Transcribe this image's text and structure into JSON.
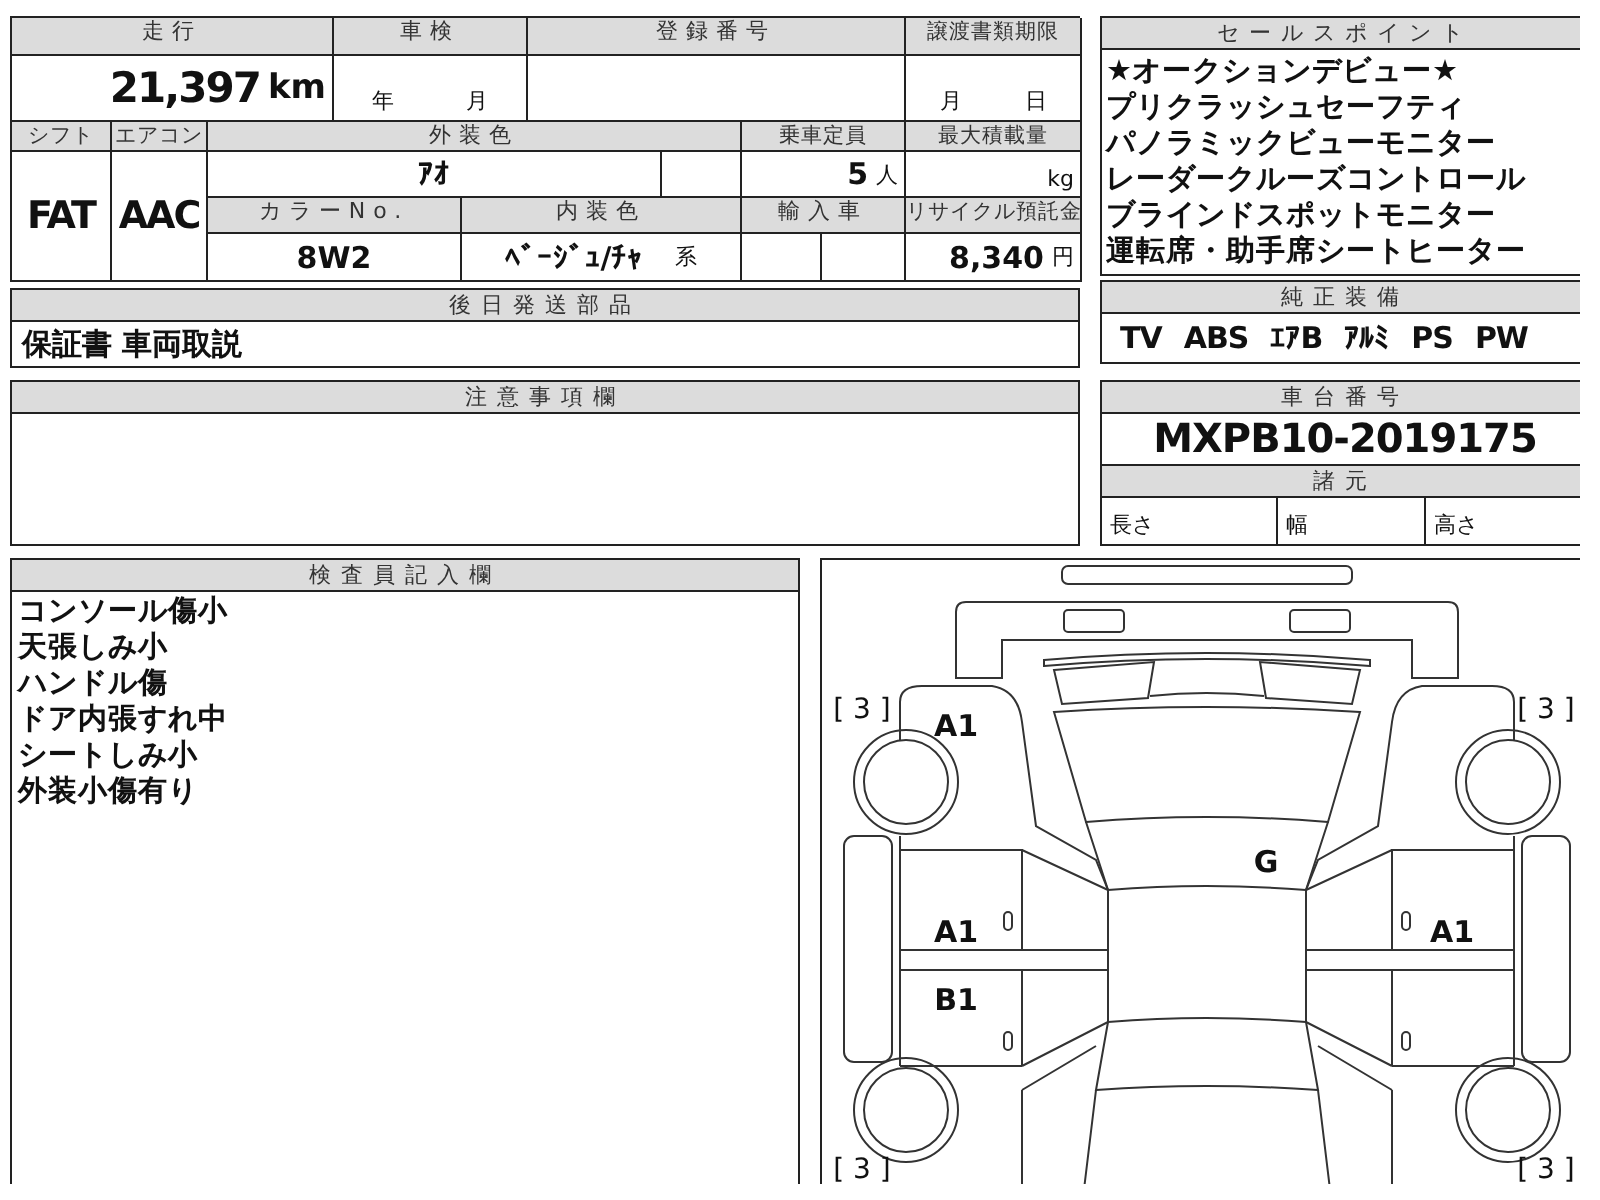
{
  "mileage": {
    "label": "走行",
    "value": "21,397",
    "unit": "km"
  },
  "inspection": {
    "label": "車検",
    "year_unit": "年",
    "month_unit": "月"
  },
  "registration": {
    "label": "登録番号"
  },
  "transfer_deadline": {
    "label": "譲渡書類期限",
    "month_unit": "月",
    "day_unit": "日"
  },
  "shift": {
    "label": "シフト",
    "value": "FAT"
  },
  "aircon": {
    "label": "エアコン",
    "value": "AAC"
  },
  "exterior_color": {
    "label": "外装色",
    "value": "ｱｵ"
  },
  "capacity": {
    "label": "乗車定員",
    "value": "5",
    "unit": "人"
  },
  "max_load": {
    "label": "最大積載量",
    "unit": "kg"
  },
  "color_no": {
    "label": "カラーNo.",
    "value": "8W2"
  },
  "interior_color": {
    "label": "内装色",
    "value": "ﾍﾞｰｼﾞｭ/ﾁｬ",
    "suffix": "系"
  },
  "import": {
    "label": "輸入車"
  },
  "recycle_fee": {
    "label": "リサイクル預託金",
    "value": "8,340",
    "unit": "円"
  },
  "later_parts": {
    "label": "後日発送部品",
    "value": "保証書 車両取説"
  },
  "notes": {
    "label": "注意事項欄"
  },
  "sale_points": {
    "label": "セールスポイント",
    "items": [
      "★オークションデビュー★",
      "プリクラッシュセーフティ",
      "パノラミックビューモニター",
      "レーダークルーズコントロール",
      "ブラインドスポットモニター",
      "運転席・助手席シートヒーター"
    ]
  },
  "equipment": {
    "label": "純正装備",
    "items": [
      "TV",
      "ABS",
      "ｴｱB",
      "ｱﾙﾐ",
      "PS",
      "PW"
    ]
  },
  "chassis": {
    "label": "車台番号",
    "value": "MXPB10-2019175"
  },
  "specs": {
    "label": "諸元",
    "items": [
      "長さ",
      "幅",
      "高さ"
    ]
  },
  "inspector": {
    "label": "検査員記入欄",
    "items": [
      "コンソール傷小",
      "天張しみ小",
      "ハンドル傷",
      "ドア内張すれ中",
      "シートしみ小",
      "外装小傷有り"
    ]
  },
  "diagram": {
    "tire_marks": [
      "[ 3 ]",
      "[ 3 ]",
      "[ 3 ]",
      "[ 3 ]"
    ],
    "damage": [
      {
        "code": "A1"
      },
      {
        "code": "G"
      },
      {
        "code": "A1"
      },
      {
        "code": "A1"
      },
      {
        "code": "B1"
      }
    ]
  }
}
